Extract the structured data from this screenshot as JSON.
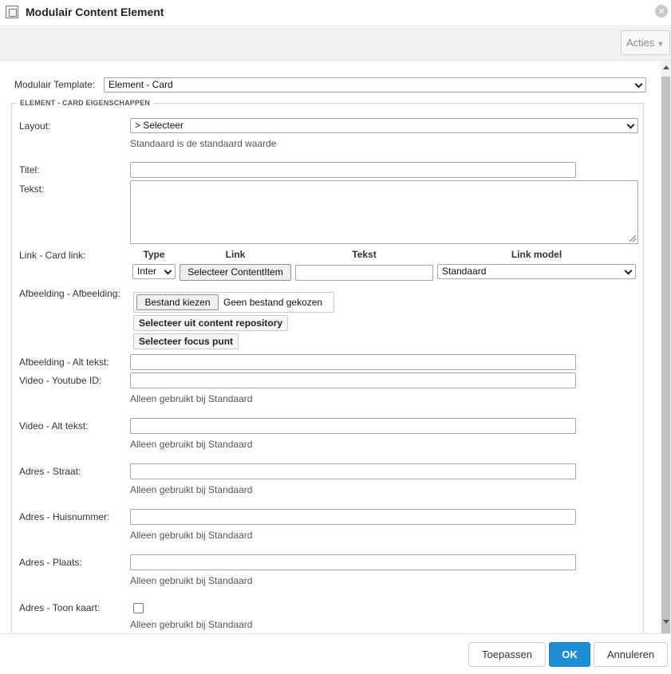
{
  "window": {
    "title": "Modulair Content Element",
    "close_icon": "close-icon"
  },
  "toolbar": {
    "actions_label": "Acties",
    "actions_caret": "▼"
  },
  "template": {
    "label": "Modulair Template:",
    "selected": "Element - Card"
  },
  "fieldset": {
    "legend": "ELEMENT - CARD EIGENSCHAPPEN"
  },
  "layout": {
    "label": "Layout:",
    "selected": "> Selecteer",
    "help": "Standaard is de standaard waarde"
  },
  "titel": {
    "label": "Titel:",
    "value": ""
  },
  "tekst": {
    "label": "Tekst:",
    "value": ""
  },
  "link": {
    "label": "Link - Card link:",
    "col_type": "Type",
    "col_link": "Link",
    "col_tekst": "Tekst",
    "col_model": "Link model",
    "type_value": "Inter",
    "select_button": "Selecteer ContentItem",
    "tekst_value": "",
    "model_value": "Standaard"
  },
  "afbeelding": {
    "label": "Afbeelding - Afbeelding:",
    "choose_button": "Bestand kiezen",
    "no_file": "Geen bestand gekozen",
    "repo_button": "Selecteer uit content repository",
    "focus_button": "Selecteer focus punt"
  },
  "alt_tekst": {
    "label": "Afbeelding - Alt tekst:",
    "value": ""
  },
  "youtube": {
    "label": "Video - Youtube ID:",
    "value": "",
    "help": "Alleen gebruikt bij Standaard"
  },
  "video_alt": {
    "label": "Video - Alt tekst:",
    "value": "",
    "help": "Alleen gebruikt bij Standaard"
  },
  "straat": {
    "label": "Adres - Straat:",
    "value": "",
    "help": "Alleen gebruikt bij Standaard"
  },
  "huisnummer": {
    "label": "Adres - Huisnummer:",
    "value": "",
    "help": "Alleen gebruikt bij Standaard"
  },
  "plaats": {
    "label": "Adres - Plaats:",
    "value": "",
    "help": "Alleen gebruikt bij Standaard"
  },
  "kaart": {
    "label": "Adres - Toon kaart:",
    "checked": false,
    "help": "Alleen gebruikt bij Standaard"
  },
  "footer": {
    "apply": "Toepassen",
    "ok": "OK",
    "cancel": "Annuleren"
  },
  "colors": {
    "primary": "#1e8fd6"
  }
}
